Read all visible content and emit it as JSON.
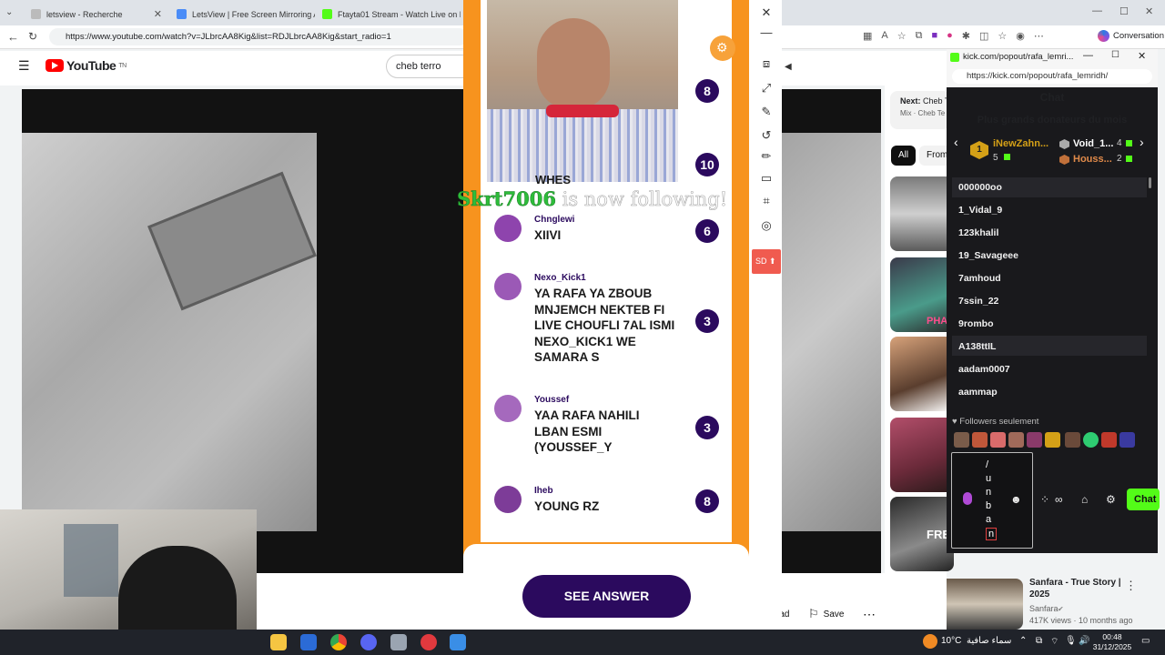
{
  "browser": {
    "tabs": [
      {
        "title": "letsview - Recherche"
      },
      {
        "title": "LetsView | Free Screen Mirroring A"
      },
      {
        "title": "Ftayta01 Stream - Watch Live on K"
      }
    ],
    "url": "https://www.youtube.com/watch?v=JLbrcAA8Kig&list=RDJLbrcAA8Kig&start_radio=1",
    "conversation_label": "Conversation"
  },
  "youtube": {
    "logo": "YouTube",
    "logo_suffix": "TN",
    "search_value": "cheb terro",
    "next_label": "Next:",
    "next_title": "Cheb T",
    "next_sub": "Mix · Cheb Te",
    "chips": [
      "All",
      "From"
    ],
    "actions": {
      "download": "Download",
      "save": "Save"
    },
    "suggestion": {
      "title": "Sanfara - True Story | 2025",
      "channel": "Sanfara",
      "meta": "417K views · 10 months ago"
    },
    "thumb_texts": [
      "FRE",
      "PHA"
    ]
  },
  "quiz": {
    "follow_user": "Skrt7006",
    "follow_text": " is now following!",
    "entries": [
      {
        "user": "",
        "message": "",
        "score": "8"
      },
      {
        "user": "",
        "message": "WHES",
        "score": "10"
      },
      {
        "user": "Chnglewi",
        "message": "XIIVI",
        "score": "6"
      },
      {
        "user": "Nexo_Kick1",
        "message": "YA RAFA YA ZBOUB MNJEMCH NEKTEB FI LIVE CHOUFLI 7AL ISMI NEXO_KICK1  WE SAMARA S",
        "score": "3"
      },
      {
        "user": "Youssef",
        "message": "YAA RAFA NAHILI LBAN ESMI (YOUSSEF_Y",
        "score": "3"
      },
      {
        "user": "Iheb",
        "message": "YOUNG RZ",
        "score": "8"
      }
    ],
    "see_answer": "SEE ANSWER",
    "sd_label": "SD"
  },
  "kick": {
    "window_title": "kick.com/popout/rafa_lemri...",
    "url": "https://kick.com/popout/rafa_lemridh/",
    "chat_title": "Chat",
    "donors_title": "Plus grands donateurs du mois",
    "donors": [
      {
        "rank": "1",
        "name": "iNewZahn...",
        "amount": "5"
      },
      {
        "rank": "",
        "name": "Void_1...",
        "amount": "4"
      },
      {
        "rank": "",
        "name": "Houss...",
        "amount": "2"
      }
    ],
    "users": [
      "000000oo",
      "1_Vidal_9",
      "123khalil",
      "19_Savageee",
      "7amhoud",
      "7ssin_22",
      "9rombo",
      "A138ttIL",
      "aadam0007",
      "aammap"
    ],
    "followers_only": "Followers seulement",
    "input_chars": [
      "/",
      "u",
      "n",
      "b",
      "a",
      "n"
    ],
    "chat_button": "Chat"
  },
  "taskbar": {
    "weather": "10°C",
    "weather_desc": "سماء صافية",
    "time": "00:48",
    "date": "31/12/2025"
  },
  "colors": {
    "quiz_orange": "#f7931e",
    "quiz_purple": "#2b0a5e",
    "kick_green": "#53fc18",
    "follow_green": "#2dbd3a"
  }
}
